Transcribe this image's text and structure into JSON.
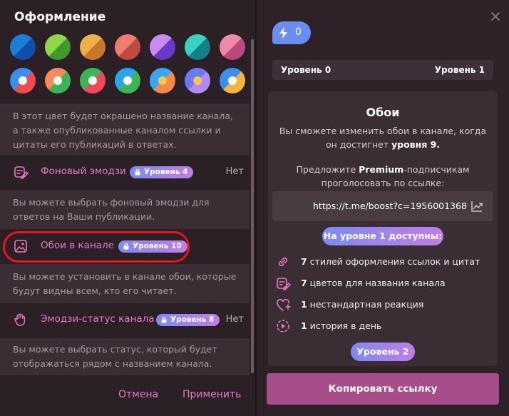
{
  "left": {
    "title": "Оформление",
    "swatch_rows": [
      [
        {
          "a": "#1a7fd4",
          "b": "#0f4fa8",
          "dot": false
        },
        {
          "a": "#8fd64a",
          "b": "#3e9a2e",
          "dot": false
        },
        {
          "a": "#f1b047",
          "b": "#c9762a",
          "dot": false
        },
        {
          "a": "#ee7d6d",
          "b": "#c04a43",
          "dot": false
        },
        {
          "a": "#c68cf0",
          "b": "#6a38c9",
          "dot": false
        },
        {
          "a": "#39d1c0",
          "b": "#137f86",
          "dot": false
        },
        {
          "a": "#ee8aa8",
          "b": "#b84a7c",
          "dot": false
        }
      ],
      [
        {
          "a": "#3a8ff0",
          "b": "#f04a4a",
          "dot": "w"
        },
        {
          "a": "#f58a5a",
          "b": "#3cb556",
          "dot": "w"
        },
        {
          "a": "#3cb556",
          "b": "#f04a5a",
          "dot": "w"
        },
        {
          "a": "#2aa6e8",
          "b": "#3cb556",
          "dot": "w"
        },
        {
          "a": "#3aa6f0",
          "b": "#f58a4a",
          "dot": "y"
        },
        {
          "a": "#6a7af0",
          "b": "#b38af0",
          "dot": "y"
        },
        {
          "a": "#3a8ff0",
          "b": "#f5b43a",
          "dot": "w"
        }
      ]
    ],
    "color_desc": "В этот цвет будет окрашено название канала, а также опубликованные каналом ссылки и цитаты его публикаций в ответах.",
    "rows": [
      {
        "label": "Фоновый эмодзи",
        "badge": "Уровень 4",
        "value": "Нет"
      },
      {
        "label": "Обои в канале",
        "badge": "Уровень 10",
        "value": ""
      },
      {
        "label": "Эмодзи-статус канала",
        "badge": "Уровень 8",
        "value": "Нет"
      }
    ],
    "descs": [
      "Вы можете выбрать фоновый эмодзи для ответов на Ваши публикации.",
      "Вы можете установить в канале обои, которые будут видны всем, кто его читает.",
      "Вы можете выбрать статус, который будет отображаться рядом с названием канала."
    ],
    "cancel": "Отмена",
    "apply": "Применить"
  },
  "right": {
    "boost_count": "0",
    "level_from": "Уровень 0",
    "level_to": "Уровень 1",
    "title": "Обои",
    "desc_pre": "Вы сможете изменить обои в канале, когда он достигнет ",
    "desc_bold": "уровня 9.",
    "prop_pre": "Предложите ",
    "prop_bold": "Premium",
    "prop_post": "-подписчикам проголосовать по ссылке:",
    "link": "https://t.me/boost?c=1956001368",
    "level1_pill": "На уровне 1 доступны:",
    "features": [
      {
        "num": "7",
        "text": " стилей оформления ссылок и цитат"
      },
      {
        "num": "7",
        "text": " цветов для названия канала"
      },
      {
        "num": "1",
        "text": " нестандартная реакция"
      },
      {
        "num": "1",
        "text": " история в день"
      }
    ],
    "level2_pill": "Уровень 2",
    "copy": "Копировать ссылку"
  },
  "colors": {
    "accent": "#e879c2",
    "button": "#a64d8a",
    "highlight": "#e8141e"
  }
}
